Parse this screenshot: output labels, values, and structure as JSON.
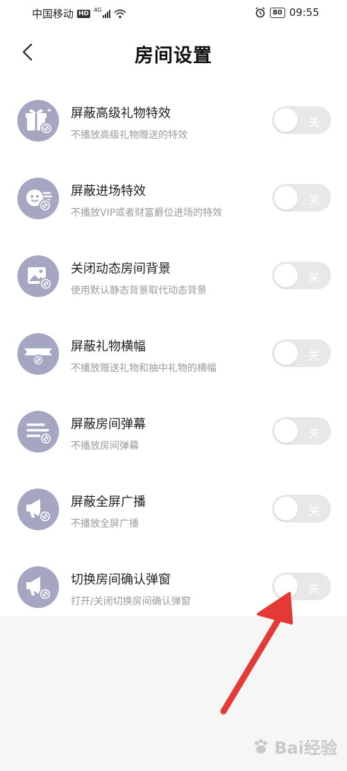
{
  "status_bar": {
    "carrier": "中国移动",
    "hd": "HD",
    "network": "4G",
    "battery": "80",
    "time": "09:55"
  },
  "header": {
    "title": "房间设置"
  },
  "settings": [
    {
      "name": "屏蔽高级礼物特效",
      "desc": "不播放高级礼物赠送的特效",
      "toggle_label": "关",
      "icon": "gift-block-icon",
      "on": false
    },
    {
      "name": "屏蔽进场特效",
      "desc": "不播放VIP或者财富爵位进场的特效",
      "toggle_label": "关",
      "icon": "entry-effect-block-icon",
      "on": false
    },
    {
      "name": "关闭动态房间背景",
      "desc": "使用默认静态背景取代动态背景",
      "toggle_label": "关",
      "icon": "background-block-icon",
      "on": false
    },
    {
      "name": "屏蔽礼物横幅",
      "desc": "不播放赠送礼物和抽中礼物的横幅",
      "toggle_label": "关",
      "icon": "banner-block-icon",
      "on": false
    },
    {
      "name": "屏蔽房间弹幕",
      "desc": "不播放房间弹幕",
      "toggle_label": "关",
      "icon": "danmaku-block-icon",
      "on": false
    },
    {
      "name": "屏蔽全屏广播",
      "desc": "不播放全屏广播",
      "toggle_label": "关",
      "icon": "broadcast-block-icon",
      "on": false
    },
    {
      "name": "切换房间确认弹窗",
      "desc": "打开/关闭切换房间确认弹窗",
      "toggle_label": "关",
      "icon": "broadcast-block-icon",
      "on": false
    }
  ],
  "watermark": {
    "text": "Bai经验"
  },
  "colors": {
    "icon_bg": "#a4a6c2",
    "toggle_off": "#e8e8e8",
    "annotation_arrow": "#e53935"
  }
}
